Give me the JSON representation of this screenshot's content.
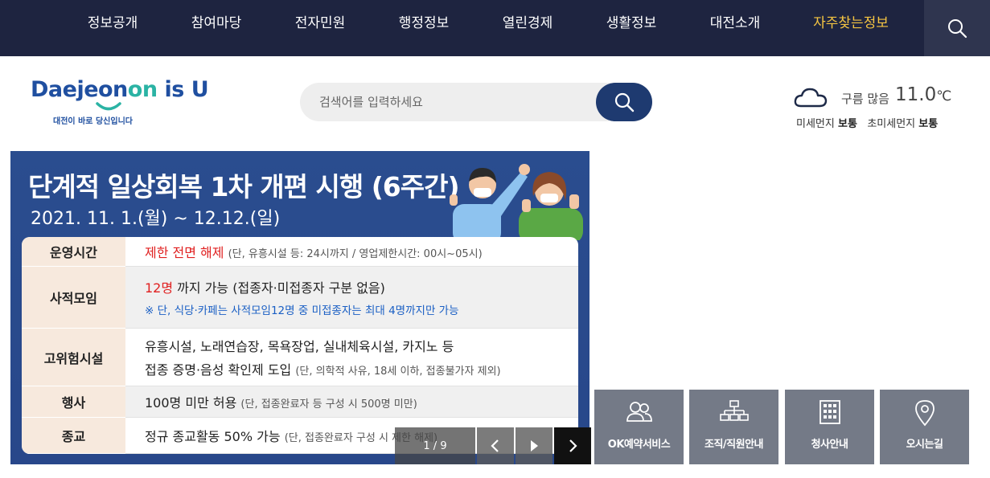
{
  "nav": {
    "items": [
      {
        "label": "정보공개"
      },
      {
        "label": "참여마당"
      },
      {
        "label": "전자민원"
      },
      {
        "label": "행정정보"
      },
      {
        "label": "열린경제"
      },
      {
        "label": "생활정보"
      },
      {
        "label": "대전소개"
      },
      {
        "label": "자주찾는정보"
      }
    ],
    "search_icon": "search-icon"
  },
  "logo": {
    "main_a": "Daejeon",
    "main_on": "on",
    "main_b": " is U",
    "sub": "대전이 바로 당신입니다"
  },
  "search": {
    "placeholder": "검색어를 입력하세요"
  },
  "weather": {
    "icon": "cloud-icon",
    "condition": "구름 많음",
    "temperature": "11.0",
    "unit": "℃",
    "fine_dust_label": "미세먼지",
    "fine_dust_value": "보통",
    "ultrafine_dust_label": "초미세먼지",
    "ultrafine_dust_value": "보통"
  },
  "banner": {
    "title": "단계적 일상회복 1차 개편 시행 (6주간)",
    "dates": "2021. 11. 1.(월) ~ 12.12.(일)",
    "rows": [
      {
        "label": "운영시간",
        "highlight": "제한 전면 해제",
        "text": " ",
        "note": "(단, 유흥시설 등: 24시까지 / 영업제한시간: 00시~05시)"
      },
      {
        "label": "사적모임",
        "highlight": "12명",
        "text": " 까지 가능 (접종자·미접종자 구분 없음)",
        "subnote": "※ 단, 식당·카페는 사적모임12명 중 미접종자는 최대 4명까지만 가능"
      },
      {
        "label": "고위험시설",
        "line1": "유흥시설, 노래연습장, 목욕장업, 실내체육시설, 카지노 등",
        "line2": "접종 증명·음성 확인제 도입",
        "note": "(단, 의학적 사유, 18세 이하, 접종불가자 제외)"
      },
      {
        "label": "행사",
        "text": "100명 미만 허용",
        "note": "(단, 접종완료자 등 구성 시 500명 미만)"
      },
      {
        "label": "종교",
        "text": "정규 종교활동 50% 가능",
        "note": "(단, 접종완료자 구성 시 제한 해제)"
      }
    ],
    "pager": {
      "current": "1",
      "total": "9",
      "text": "1 / 9"
    }
  },
  "quicklinks": [
    {
      "label": "OK예약서비스",
      "icon": "users-icon"
    },
    {
      "label": "조직/직원안내",
      "icon": "org-chart-icon"
    },
    {
      "label": "청사안내",
      "icon": "building-icon"
    },
    {
      "label": "오시는길",
      "icon": "location-pin-icon"
    }
  ]
}
